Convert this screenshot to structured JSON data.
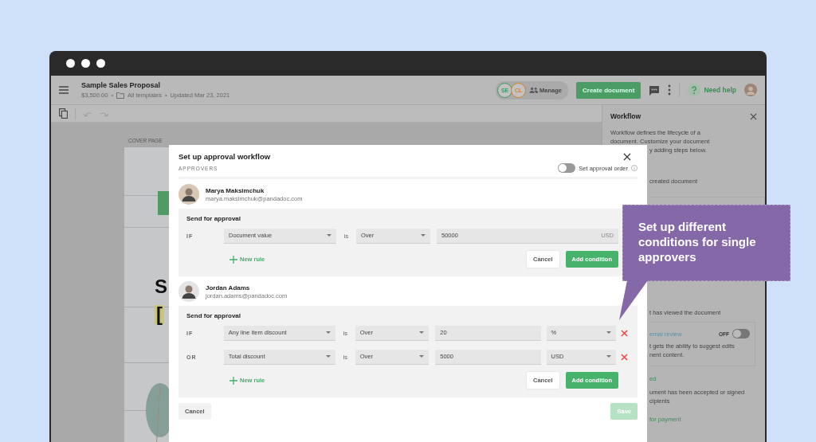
{
  "document_header": {
    "title": "Sample Sales Proposal",
    "amount": "$3,500.00",
    "folder": "All templates",
    "updated": "Updated Mar 23, 2021"
  },
  "collaborators": [
    {
      "initials": "SE",
      "color": "#3f9a67"
    },
    {
      "initials": "CL",
      "color": "#d9822b"
    }
  ],
  "manage_button": "Manage",
  "create_button": "Create document",
  "help_link": "Need help",
  "meta_separator": [
    "•",
    "•"
  ],
  "canvas": {
    "page_label": "COVER PAGE",
    "heading_fragments": [
      "S",
      "["
    ]
  },
  "sidebar": {
    "title": "Workflow",
    "intro": [
      "Workflow defines the lifecycle of a",
      "document. Customize your document"
    ],
    "fragments_top": [
      {
        "kind": "text",
        "text": "y adding steps below."
      },
      {
        "kind": "text",
        "text": "created document"
      }
    ],
    "fragments_bottom": [
      {
        "kind": "text",
        "text": "t has viewed the document"
      }
    ],
    "review_card": {
      "label": "ernal review",
      "toggle_label": "OFF",
      "on": false,
      "description": [
        "t gets the ability to suggest edits",
        "nent content."
      ]
    },
    "fragments_end": [
      {
        "kind": "step",
        "text": "ed"
      },
      {
        "kind": "text",
        "text": "ument has been accepted or signed"
      },
      {
        "kind": "text",
        "text": "cipients"
      },
      {
        "kind": "step",
        "text": "for payment"
      }
    ]
  },
  "modal": {
    "title": "Set up approval workflow",
    "section_label": "APPROVERS",
    "approval_order": {
      "label": "Set approval order",
      "on": false
    },
    "approvers": [
      {
        "name": "Marya Maksimchuk",
        "email": "marya.maksimchuk@pandadoc.com",
        "block_title": "Send for approval",
        "rules": [
          {
            "connector": "IF",
            "field": "Document value",
            "is": "is",
            "comparator": "Over",
            "value": "50000",
            "unit": "USD",
            "kind": "suffix"
          }
        ],
        "new_rule": "New rule",
        "cancel": "Cancel",
        "add": "Add condition"
      },
      {
        "name": "Jordan Adams",
        "email": "jordan.adams@pandadoc.com",
        "block_title": "Send for approval",
        "rules": [
          {
            "connector": "IF",
            "field": "Any line item discount",
            "is": "is",
            "comparator": "Over",
            "value": "20",
            "unit": "%",
            "kind": "select"
          },
          {
            "connector": "OR",
            "field": "Total discount",
            "is": "is",
            "comparator": "Over",
            "value": "5000",
            "unit": "USD",
            "kind": "select"
          }
        ],
        "new_rule": "New rule",
        "cancel": "Cancel",
        "add": "Add condition"
      }
    ],
    "cancel": "Cancel",
    "save": {
      "label": "Save",
      "disabled": true
    }
  },
  "callout": {
    "text": "Set up different conditions for single approvers"
  }
}
